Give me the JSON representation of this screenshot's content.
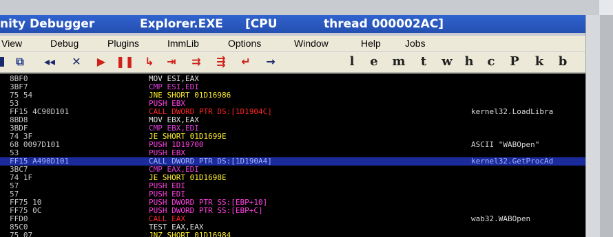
{
  "title": {
    "app": "nity Debugger",
    "file": "Explorer.EXE",
    "cpu": "[CPU",
    "thread": "thread 000002AC]"
  },
  "menu": [
    "View",
    "Debug",
    "Plugins",
    "ImmLib",
    "Options",
    "Window",
    "Help",
    "Jobs"
  ],
  "toolbar": {
    "buttons": [
      {
        "name": "window-icon",
        "glyph": "⧉",
        "color": "#1f3a8a"
      },
      {
        "name": "rewind-icon",
        "glyph": "◂◂",
        "color": "#1a2a6c"
      },
      {
        "name": "close-icon",
        "glyph": "✕",
        "color": "#1a2a6c"
      },
      {
        "name": "run-icon",
        "glyph": "▶",
        "color": "#d0201a"
      },
      {
        "name": "pause-icon",
        "glyph": "❚❚",
        "color": "#d0201a"
      },
      {
        "name": "step-into-icon",
        "glyph": "↳",
        "color": "#d0201a"
      },
      {
        "name": "step-over-icon",
        "glyph": "⇥",
        "color": "#d0201a"
      },
      {
        "name": "animate-into-icon",
        "glyph": "⇉",
        "color": "#d0201a"
      },
      {
        "name": "animate-over-icon",
        "glyph": "⇶",
        "color": "#d0201a"
      },
      {
        "name": "execute-till-return-icon",
        "glyph": "↵",
        "color": "#d0201a"
      },
      {
        "name": "go-to-icon",
        "glyph": "→",
        "color": "#1a2a6c"
      }
    ],
    "letters": [
      "l",
      "e",
      "m",
      "t",
      "w",
      "h",
      "c",
      "P",
      "k",
      "b"
    ]
  },
  "colors": {
    "mov": "#e0e0e0",
    "cmp": "#e33de0",
    "jump": "#ffef2e",
    "call": "#ff2424",
    "stack": "#ff40e0",
    "sel_fg": "#a6b3ff"
  },
  "rows": [
    {
      "hex": "8BF0",
      "mn": "MOV",
      "ops": "ESI,EAX",
      "kind": "mov",
      "com": ""
    },
    {
      "hex": "3BF7",
      "mn": "CMP",
      "ops": "ESI,EDI",
      "kind": "cmp",
      "com": ""
    },
    {
      "hex": "75 54",
      "mn": "JNE",
      "ops": "SHORT 01D16986",
      "kind": "jump",
      "com": ""
    },
    {
      "hex": "53",
      "mn": "PUSH",
      "ops": "EBX",
      "kind": "stack",
      "com": ""
    },
    {
      "hex": "FF15 4C90D101",
      "mn": "CALL",
      "ops": "DWORD PTR DS:[1D1904C]",
      "kind": "call",
      "com": "kernel32.LoadLibra"
    },
    {
      "hex": "8BD8",
      "mn": "MOV",
      "ops": "EBX,EAX",
      "kind": "mov",
      "com": ""
    },
    {
      "hex": "3BDF",
      "mn": "CMP",
      "ops": "EBX,EDI",
      "kind": "cmp",
      "com": ""
    },
    {
      "hex": "74 3F",
      "mn": "JE",
      "ops": "SHORT 01D1699E",
      "kind": "jump",
      "com": ""
    },
    {
      "hex": "68 0097D101",
      "mn": "PUSH",
      "ops": "1D19700",
      "kind": "stack",
      "com": "ASCII \"WABOpen\""
    },
    {
      "hex": "53",
      "mn": "PUSH",
      "ops": "EBX",
      "kind": "stack",
      "com": ""
    },
    {
      "hex": "FF15 A490D101",
      "mn": "CALL",
      "ops": "DWORD PTR DS:[1D190A4]",
      "kind": "call",
      "com": "kernel32.GetProcAd",
      "selected": true
    },
    {
      "hex": "3BC7",
      "mn": "CMP",
      "ops": "EAX,EDI",
      "kind": "cmp",
      "com": ""
    },
    {
      "hex": "74 1F",
      "mn": "JE",
      "ops": "SHORT 01D1698E",
      "kind": "jump",
      "com": ""
    },
    {
      "hex": "57",
      "mn": "PUSH",
      "ops": "EDI",
      "kind": "stack",
      "com": ""
    },
    {
      "hex": "57",
      "mn": "PUSH",
      "ops": "EDI",
      "kind": "stack",
      "com": ""
    },
    {
      "hex": "FF75 10",
      "mn": "PUSH",
      "ops": "DWORD PTR SS:[EBP+10]",
      "kind": "stack",
      "com": ""
    },
    {
      "hex": "FF75 0C",
      "mn": "PUSH",
      "ops": "DWORD PTR SS:[EBP+C]",
      "kind": "stack",
      "com": ""
    },
    {
      "hex": "FFD0",
      "mn": "CALL",
      "ops": "EAX",
      "kind": "call",
      "com": "wab32.WABOpen"
    },
    {
      "hex": "85C0",
      "mn": "TEST",
      "ops": "EAX,EAX",
      "kind": "mov",
      "com": ""
    },
    {
      "hex": "75 07",
      "mn": "JNZ",
      "ops": "SHORT 01D16984",
      "kind": "jump",
      "com": ""
    }
  ]
}
